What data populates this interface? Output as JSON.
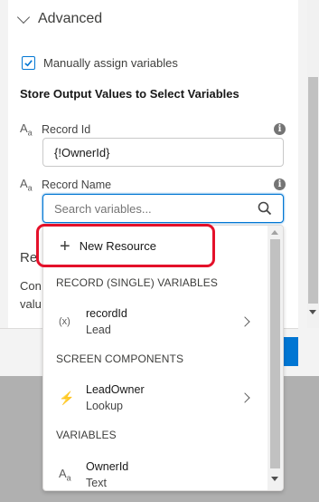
{
  "advanced": {
    "title": "Advanced"
  },
  "checkbox": {
    "label": "Manually assign variables",
    "checked": true
  },
  "output_section": {
    "heading": "Store Output Values to Select Variables"
  },
  "fields": {
    "record_id": {
      "icon": "Aa",
      "label": "Record Id",
      "value": "{!OwnerId}"
    },
    "record_name": {
      "icon": "Aa",
      "label": "Record Name",
      "placeholder": "Search variables..."
    }
  },
  "background": {
    "heading_partial": "Re",
    "text_line1": "Con",
    "text_line2": "valu"
  },
  "dropdown": {
    "new_resource_label": "New Resource",
    "sections": [
      {
        "title": "RECORD (SINGLE) VARIABLES",
        "items": [
          {
            "icon": "(x)",
            "name": "recordId",
            "sub": "Lead",
            "has_children": true
          }
        ]
      },
      {
        "title": "SCREEN COMPONENTS",
        "items": [
          {
            "icon": "⚡",
            "name": "LeadOwner",
            "sub": "Lookup",
            "has_children": true
          }
        ]
      },
      {
        "title": "VARIABLES",
        "items": [
          {
            "icon": "Aa",
            "name": "OwnerId",
            "sub": "Text",
            "has_children": false
          }
        ]
      }
    ]
  },
  "colors": {
    "accent": "#0176d3",
    "highlight": "#e4112a"
  },
  "icons": {
    "section_toggle": "chevron-down-icon",
    "checkbox": "checkmark-icon",
    "field_type": "text-type-icon",
    "info": "info-icon",
    "search": "search-icon",
    "new_resource": "plus-icon",
    "record_var": "variable-icon",
    "screen_component": "lightning-icon",
    "text_var": "text-type-icon",
    "expand": "chevron-right-icon"
  }
}
